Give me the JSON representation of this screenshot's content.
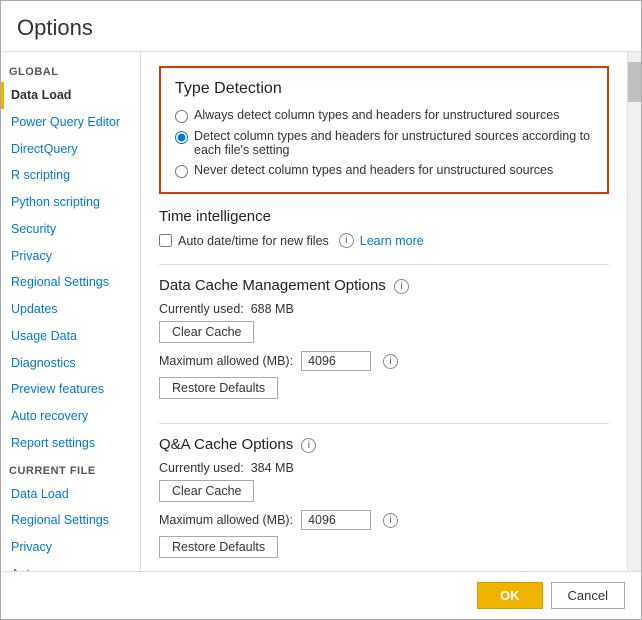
{
  "dialog": {
    "title": "Options",
    "ok_label": "OK",
    "cancel_label": "Cancel"
  },
  "sidebar": {
    "global_label": "GLOBAL",
    "current_file_label": "CURRENT FILE",
    "global_items": [
      {
        "id": "data-load",
        "label": "Data Load",
        "active": true
      },
      {
        "id": "power-query-editor",
        "label": "Power Query Editor",
        "active": false
      },
      {
        "id": "directquery",
        "label": "DirectQuery",
        "active": false
      },
      {
        "id": "r-scripting",
        "label": "R scripting",
        "active": false
      },
      {
        "id": "python-scripting",
        "label": "Python scripting",
        "active": false
      },
      {
        "id": "security",
        "label": "Security",
        "active": false
      },
      {
        "id": "privacy",
        "label": "Privacy",
        "active": false
      },
      {
        "id": "regional-settings",
        "label": "Regional Settings",
        "active": false
      },
      {
        "id": "updates",
        "label": "Updates",
        "active": false
      },
      {
        "id": "usage-data",
        "label": "Usage Data",
        "active": false
      },
      {
        "id": "diagnostics",
        "label": "Diagnostics",
        "active": false
      },
      {
        "id": "preview-features",
        "label": "Preview features",
        "active": false
      },
      {
        "id": "auto-recovery",
        "label": "Auto recovery",
        "active": false
      },
      {
        "id": "report-settings",
        "label": "Report settings",
        "active": false
      }
    ],
    "current_file_items": [
      {
        "id": "cf-data-load",
        "label": "Data Load",
        "active": false
      },
      {
        "id": "cf-regional-settings",
        "label": "Regional Settings",
        "active": false
      },
      {
        "id": "cf-privacy",
        "label": "Privacy",
        "active": false
      },
      {
        "id": "cf-auto-recovery",
        "label": "Auto recovery",
        "active": false
      }
    ]
  },
  "main": {
    "type_detection": {
      "title": "Type Detection",
      "options": [
        {
          "id": "always",
          "label": "Always detect column types and headers for unstructured sources",
          "checked": false
        },
        {
          "id": "per-file",
          "label": "Detect column types and headers for unstructured sources according to each file's setting",
          "checked": true
        },
        {
          "id": "never",
          "label": "Never detect column types and headers for unstructured sources",
          "checked": false
        }
      ]
    },
    "time_intelligence": {
      "title": "Time intelligence",
      "checkbox_label": "Auto date/time for new files",
      "learn_more": "Learn more",
      "checked": false
    },
    "data_cache": {
      "title": "Data Cache Management Options",
      "currently_used_label": "Currently used:",
      "currently_used_value": "688 MB",
      "clear_cache_label": "Clear Cache",
      "max_label": "Maximum allowed (MB):",
      "max_value": "4096",
      "restore_label": "Restore Defaults"
    },
    "qa_cache": {
      "title": "Q&A Cache Options",
      "currently_used_label": "Currently used:",
      "currently_used_value": "384 MB",
      "clear_cache_label": "Clear Cache",
      "max_label": "Maximum allowed (MB):",
      "max_value": "4096",
      "restore_label": "Restore Defaults"
    }
  }
}
